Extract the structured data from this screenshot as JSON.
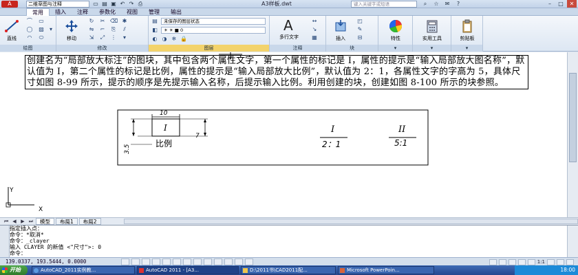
{
  "titlebar": {
    "app_button": "A",
    "workspace": "二维草图与注释",
    "title": "A3样板.dwt",
    "search_placeholder": "键入关键字或短语"
  },
  "ribbon_tabs": [
    "常用",
    "插入",
    "注释",
    "参数化",
    "视图",
    "管理",
    "输出"
  ],
  "ribbon": {
    "draw": {
      "line_label": "直线",
      "title": "绘图"
    },
    "modify": {
      "move_label": "移动",
      "title": "修改"
    },
    "layers": {
      "state": "未保存的图层状态",
      "current": "0",
      "title": "图层"
    },
    "annotation": {
      "mtext_label": "多行文字",
      "title": "注释"
    },
    "block": {
      "insert_label": "插入",
      "title": "块"
    },
    "properties": {
      "label": "特性"
    },
    "utilities": {
      "label": "实用工具"
    },
    "clipboard": {
      "label": "剪贴板"
    }
  },
  "drawing": {
    "paragraph": "创建名为“局部放大标注”的图块，其中包含两个属性文字，第一个属性的标记是 I，属性的提示是“输入局部放大图名称”，默认值为 I，第二个属性的标记是比例，属性的提示是“输入局部放大比例”，默认值为 2：1，各属性文字的字高为 5，具体尺寸如图 8-99 所示，提示的顺序是先提示输入名称，后提示输入比例。利用创建的块，创建如图 8-100 所示的块参照。",
    "dim_width": "10",
    "dim_height": "7",
    "dim_gap": "3.5",
    "attr_tag_name": "I",
    "attr_tag_scale": "比例",
    "block1_name": "I",
    "block1_scale": "2：1",
    "block2_name": "II",
    "block2_scale": "5:1",
    "ucs_y": "Y",
    "ucs_x": "X"
  },
  "layout_tabs": [
    "模型",
    "布局1",
    "布局2"
  ],
  "command_lines": [
    "指定插入点：",
    "命令：*取消*",
    "命令：_clayer",
    "输入 CLAYER 的新值 <\"尺寸\">: 0",
    "命令："
  ],
  "status": {
    "coords": "139.0337, 193.5444, 0.0000",
    "annotation_scale": "1:1"
  },
  "taskbar": {
    "start": "开始",
    "tasks": [
      "AutoCAD_2011实例教...",
      "AutoCAD 2011 - [A3...",
      "D:\\2011书\\CAD2011配...",
      "Microsoft PowerPoin..."
    ],
    "clock": "18:00"
  },
  "colors": {
    "canvas": "#ffffff",
    "titlebar": "#c2d3e9",
    "taskbar": "#24478f",
    "layer_selected": "#f3d36b"
  }
}
